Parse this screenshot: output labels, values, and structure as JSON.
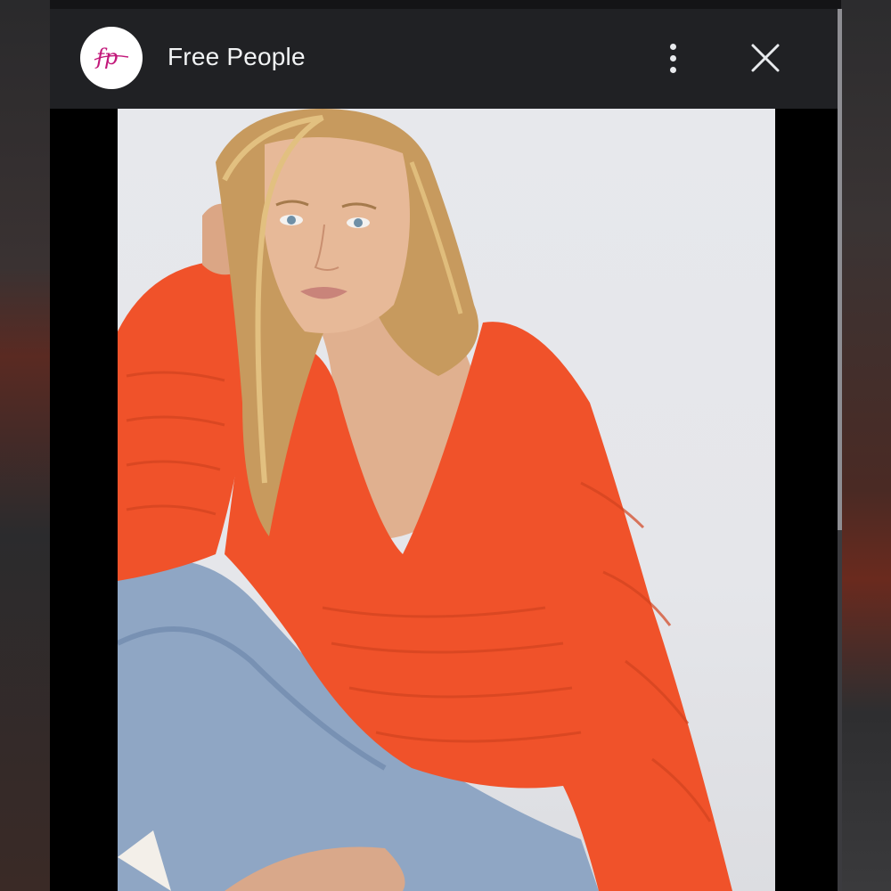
{
  "header": {
    "brand_name": "Free People",
    "avatar_monogram": "fp",
    "avatar_icon": "brand-logo-icon",
    "more_icon": "more-vert-icon",
    "close_icon": "close-icon"
  },
  "photo": {
    "subject": "product-photo"
  },
  "colors": {
    "header_bg": "#202124",
    "sweater": "#f0522a",
    "monogram": "#c2187a"
  }
}
